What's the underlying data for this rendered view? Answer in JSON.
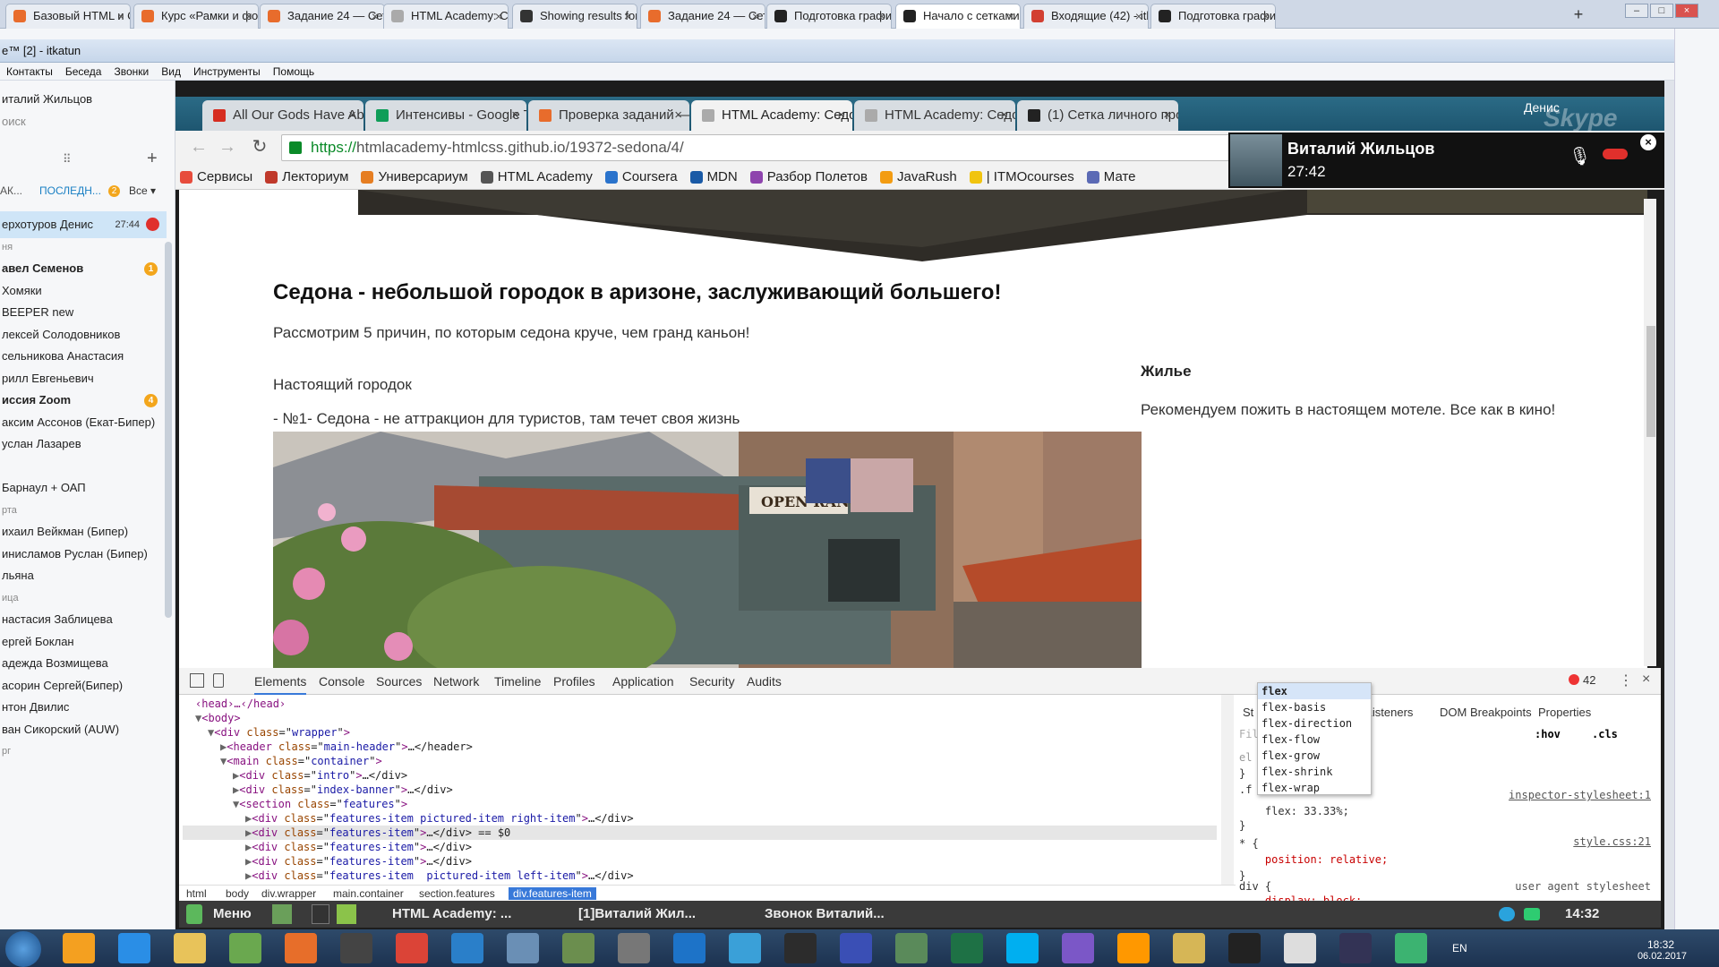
{
  "outer_browser": {
    "tabs": [
      {
        "label": "Базовый HTML и С...",
        "color": "#e86c2c"
      },
      {
        "label": "Курс «Рамки и фон...",
        "color": "#e86c2c"
      },
      {
        "label": "Задание 24 — Сетк...",
        "color": "#e86c2c"
      },
      {
        "label": "HTML Academy: Седона",
        "color": "#aaaaaa"
      },
      {
        "label": "Showing results for ...",
        "color": "#333333"
      },
      {
        "label": "Задание 24 — Сетк...",
        "color": "#e86c2c"
      },
      {
        "label": "Подготовка графи...",
        "color": "#222222"
      },
      {
        "label": "Начало с сетками ...",
        "color": "#222222"
      },
      {
        "label": "Входящие (42) - itk...",
        "color": "#d23f31"
      },
      {
        "label": "Подготовка графи...",
        "color": "#222222"
      }
    ],
    "active_tab": 7,
    "new_tab": "+",
    "close_glyph": "×"
  },
  "skype": {
    "title": "e™ [2] - itkatun",
    "menu": [
      "Контакты",
      "Беседа",
      "Звонки",
      "Вид",
      "Инструменты",
      "Помощь"
    ],
    "profile_name": "италий Жильцов",
    "search_placeholder": "оиск",
    "filters": {
      "contacts": "АК...",
      "recent": "ПОСЛЕДН...",
      "recent_badge": "2",
      "all": "Все"
    },
    "contacts": [
      {
        "name": "ерхотуров Денис",
        "time": "27:44",
        "selected": true
      },
      {
        "name": "ня",
        "group": true
      },
      {
        "name": "авел Семенов",
        "bold": true,
        "badge": "1"
      },
      {
        "name": "Хомяки"
      },
      {
        "name": "BEEPER new"
      },
      {
        "name": "лексей Солодовников"
      },
      {
        "name": "сельникова Анастасия"
      },
      {
        "name": "рилл Евгеньевич"
      },
      {
        "name": "иссия Zoom",
        "bold": true,
        "badge": "4"
      },
      {
        "name": "аксим Ассонов (Екат-Бипер)"
      },
      {
        "name": "услан Лазарев"
      },
      {
        "name": ""
      },
      {
        "name": "Барнаул + ОАП"
      },
      {
        "name": "рта",
        "group": true
      },
      {
        "name": "ихаил Вейкман (Бипер)"
      },
      {
        "name": "инисламов Руслан (Бипер)"
      },
      {
        "name": "льяна"
      },
      {
        "name": "ица",
        "group": true
      },
      {
        "name": "настасия Заблицева"
      },
      {
        "name": "ергей Боклан"
      },
      {
        "name": "адежда Возмищева"
      },
      {
        "name": "асорин Сергей(Бипер)"
      },
      {
        "name": "нтон Двилис"
      },
      {
        "name": "ван Сикорский (AUW)"
      },
      {
        "name": "рг",
        "group": true
      }
    ]
  },
  "inner_browser": {
    "tabs": [
      {
        "label": "All Our Gods Have Aba",
        "color": "#d62d20"
      },
      {
        "label": "Интенсивы - Google T",
        "color": "#0f9d58"
      },
      {
        "label": "Проверка заданий —",
        "color": "#e86c2c"
      },
      {
        "label": "HTML Academy: Седон",
        "color": "#aaaaaa"
      },
      {
        "label": "HTML Academy: Седон",
        "color": "#aaaaaa"
      },
      {
        "label": "(1) Сетка личного про",
        "color": "#222222"
      }
    ],
    "active_tab": 3,
    "profile_name": "Денис",
    "url_scheme": "https://",
    "url_rest": "htmlacademy-htmlcss.github.io/19372-sedona/4/",
    "bookmarks": [
      {
        "label": "Сервисы",
        "color": "#e74c3c"
      },
      {
        "label": "Лекториум",
        "color": "#c0392b"
      },
      {
        "label": "Универсариум",
        "color": "#e67e22"
      },
      {
        "label": "HTML Academy",
        "color": "#555555"
      },
      {
        "label": "Coursera",
        "color": "#2a73cc"
      },
      {
        "label": "MDN",
        "color": "#1a5aa6"
      },
      {
        "label": "Разбор Полетов",
        "color": "#8e44ad"
      },
      {
        "label": "JavaRush",
        "color": "#f39c12"
      },
      {
        "label": "| ITMOcourses",
        "color": "#f1c40f"
      },
      {
        "label": "Мате",
        "color": "#5b6ab5"
      }
    ]
  },
  "page": {
    "heading": "Седона - небольшой городок в аризоне, заслуживающий большего!",
    "lead": "Рассмотрим 5 причин, по которым седона круче, чем гранд каньон!",
    "town_title": "Настоящий городок",
    "reason": "- №1- Седона - не аттракцион для туристов, там течет своя жизнь",
    "housing_title": "Жилье",
    "housing_text": "Рекомендуем пожить в настоящем мотеле. Все как в кино!",
    "photo_sign": "OPEN RANGE"
  },
  "call": {
    "name": "Виталий Жильцов",
    "time": "27:42",
    "watermark": "Skype"
  },
  "devtools": {
    "tabs": [
      "Elements",
      "Console",
      "Sources",
      "Network",
      "Timeline",
      "Profiles",
      "Application",
      "Security",
      "Audits"
    ],
    "active_tab": 0,
    "error_count": "42",
    "dom_lines": [
      {
        "indent": 1,
        "tri": "",
        "html": "‹head›…‹/head›"
      },
      {
        "indent": 1,
        "tri": "▼",
        "tag": "body",
        "attrs": ""
      },
      {
        "indent": 2,
        "tri": "▼",
        "tag": "div",
        "cls": "wrapper",
        "close": ""
      },
      {
        "indent": 3,
        "tri": "▶",
        "tag": "header",
        "cls": "main-header",
        "close": "…</header>"
      },
      {
        "indent": 3,
        "tri": "▼",
        "tag": "main",
        "cls": "container",
        "close": ""
      },
      {
        "indent": 4,
        "tri": "▶",
        "tag": "div",
        "cls": "intro",
        "close": "…</div>"
      },
      {
        "indent": 4,
        "tri": "▶",
        "tag": "div",
        "cls": "index-banner",
        "close": "…</div>"
      },
      {
        "indent": 4,
        "tri": "▼",
        "tag": "section",
        "cls": "features",
        "close": ""
      },
      {
        "indent": 5,
        "tri": "▶",
        "tag": "div",
        "cls": "features-item pictured-item right-item",
        "close": "…</div>"
      },
      {
        "indent": 5,
        "tri": "▶",
        "tag": "div",
        "cls": "features-item",
        "close": "…</div> == $0",
        "selected": true
      },
      {
        "indent": 5,
        "tri": "▶",
        "tag": "div",
        "cls": "features-item",
        "close": "…</div>"
      },
      {
        "indent": 5,
        "tri": "▶",
        "tag": "div",
        "cls": "features-item",
        "close": "…</div>"
      },
      {
        "indent": 5,
        "tri": "▶",
        "tag": "div",
        "cls": "features-item  pictured-item left-item",
        "close": "…</div>"
      }
    ],
    "breadcrumbs": [
      "html",
      "body",
      "div.wrapper",
      "main.container",
      "section.features",
      "div.features-item"
    ],
    "styles_tabs": [
      "St",
      "ent Listeners",
      "DOM Breakpoints",
      "Properties"
    ],
    "hov": ":hov",
    "cls": ".cls",
    "filter_placeholder": "Fil",
    "rules": [
      {
        "text": "el",
        "color": "#999"
      },
      {
        "text": "}",
        "color": "#333"
      },
      {
        "text": ".f",
        "color": "#333"
      },
      {
        "text": "    flex: 33.33%;",
        "color": "#333"
      },
      {
        "text": "}",
        "color": "#333"
      },
      {
        "text": "* {",
        "color": "#333"
      },
      {
        "text": "    position: relative;",
        "color": "#c80000"
      },
      {
        "text": "}",
        "color": "#333"
      },
      {
        "text": "div {",
        "color": "#333"
      },
      {
        "text": "    display: block;",
        "color": "#c80000"
      }
    ],
    "sources": [
      "inspector-stylesheet:1",
      "style.css:21",
      "user agent stylesheet"
    ],
    "autocomplete": [
      "flex",
      "flex-basis",
      "flex-direction",
      "flex-flow",
      "flex-grow",
      "flex-shrink",
      "flex-wrap"
    ]
  },
  "linux_panel": {
    "menu": "Меню",
    "windows": [
      "HTML Academy: ...",
      "[1]Виталий Жил...",
      "Звонок Виталий..."
    ],
    "time": "14:32"
  },
  "taskbar": {
    "lang": "EN",
    "time": "18:32",
    "date": "06.02.2017",
    "icons": [
      "outlook-icon",
      "ie-icon",
      "explorer-icon",
      "notepad-icon",
      "firefox-icon",
      "headphones-icon",
      "chrome-icon",
      "phone-icon",
      "network-icon",
      "turtle-icon",
      "database-icon",
      "teamviewer-icon",
      "calendar-icon",
      "hs-icon",
      "floppy-icon",
      "monitor-icon",
      "excel-icon",
      "skype-icon",
      "github-icon",
      "sublime-icon",
      "tools-icon",
      "terminal-icon",
      "archive-icon",
      "rider-icon",
      "slack-icon"
    ],
    "icon_colors": [
      "#f4a020",
      "#2a8ee6",
      "#e8c35a",
      "#6aa84f",
      "#e76e2a",
      "#444444",
      "#db4437",
      "#2a7fc9",
      "#6a8fb5",
      "#6b8e4e",
      "#777777",
      "#1d73c8",
      "#3aa0d8",
      "#2c2c2c",
      "#3a4fb5",
      "#5a8a5a",
      "#1e7145",
      "#00aff0",
      "#7b57c7",
      "#ff9800",
      "#d6b656",
      "#222222",
      "#dddddd",
      "#333355",
      "#3cb371"
    ]
  }
}
